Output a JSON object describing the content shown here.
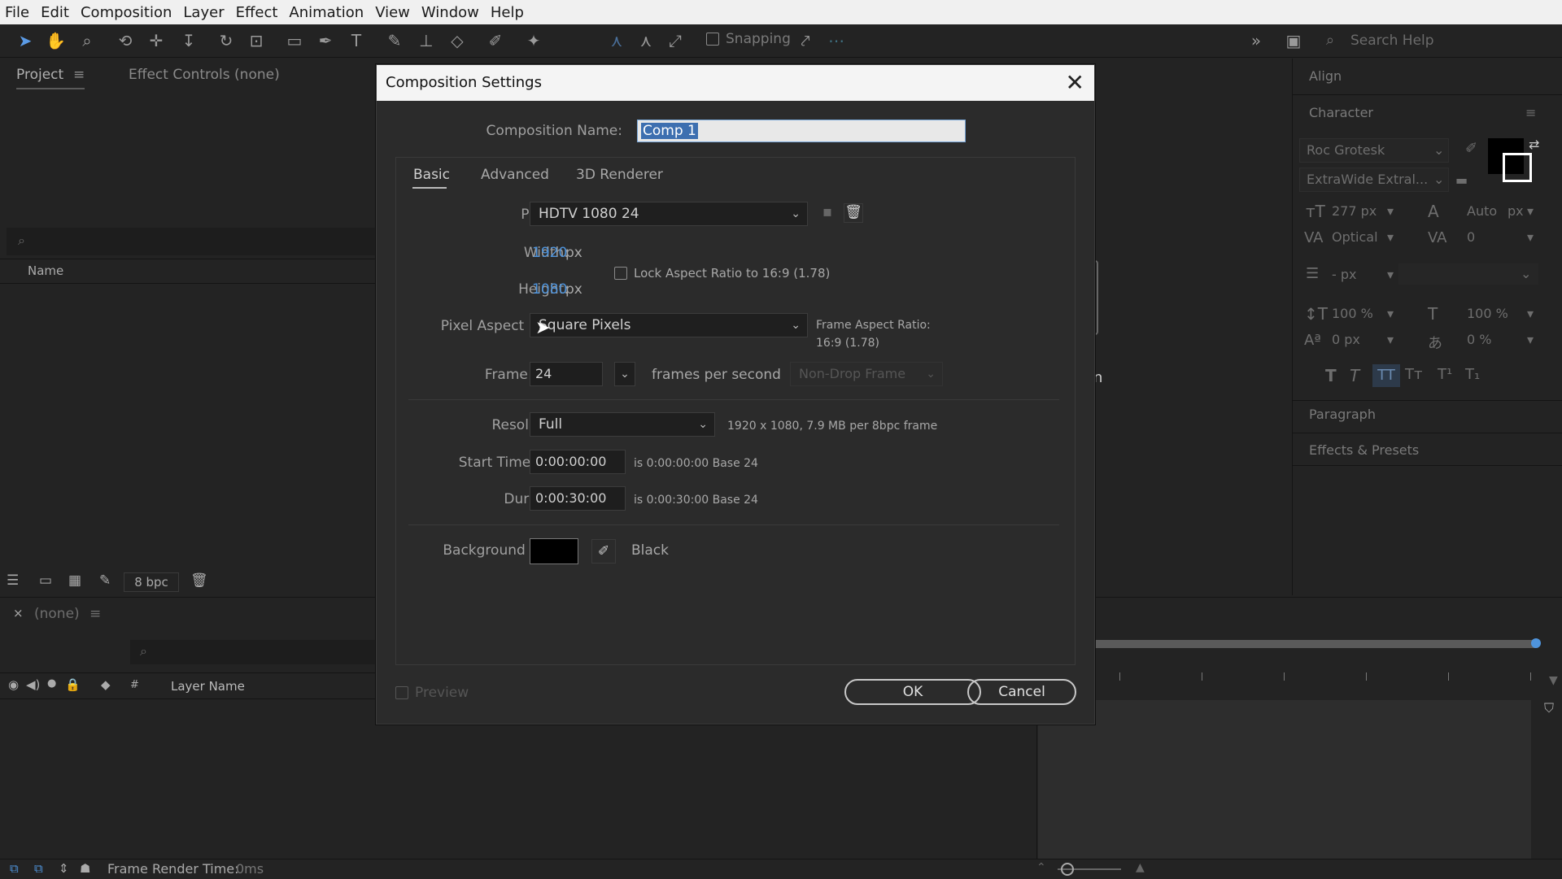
{
  "menu": [
    "File",
    "Edit",
    "Composition",
    "Layer",
    "Effect",
    "Animation",
    "View",
    "Window",
    "Help"
  ],
  "toolbar": {
    "snapping_label": "Snapping",
    "search_placeholder": "Search Help"
  },
  "project_panel": {
    "tab_project": "Project",
    "tab_effect_controls": "Effect Controls (none)",
    "column_name": "Name",
    "bpc": "8 bpc"
  },
  "timeline_panel": {
    "tab_label": "(none)",
    "column_layer_name": "Layer Name",
    "column_hash": "#",
    "frame_render_label": "Frame Render Time:",
    "frame_render_value": "0ms"
  },
  "right_panel": {
    "align": "Align",
    "character": "Character",
    "font": "Roc Grotesk",
    "font_style": "ExtraWide Extral...",
    "size": "277 px",
    "leading": "Auto",
    "leading_unit": "px",
    "kerning": "Optical",
    "tracking": "0",
    "stroke_width": "- px",
    "vscale": "100 %",
    "hscale": "100 %",
    "baseline": "0 px",
    "tsume": "0 %",
    "paragraph": "Paragraph",
    "effects_presets": "Effects & Presets"
  },
  "dialog": {
    "title": "Composition Settings",
    "comp_name_label": "Composition Name:",
    "comp_name_value": "Comp 1",
    "tabs": [
      "Basic",
      "Advanced",
      "3D Renderer"
    ],
    "preset_label": "Preset:",
    "preset_value": "HDTV 1080 24",
    "width_label": "Width:",
    "width_value": "1920",
    "width_unit": "px",
    "height_label": "Height:",
    "height_value": "1080",
    "height_unit": "px",
    "lock_aspect_label": "Lock Aspect Ratio to 16:9 (1.78)",
    "par_label": "Pixel Aspect Ratio:",
    "par_value": "Square Pixels",
    "far_label": "Frame Aspect Ratio:",
    "far_value": "16:9 (1.78)",
    "framerate_label": "Frame Rate:",
    "framerate_value": "24",
    "fps_label": "frames per second",
    "drop_frame": "Non-Drop Frame",
    "resolution_label": "Resolution:",
    "resolution_value": "Full",
    "resolution_info": "1920 x 1080, 7.9 MB per 8bpc frame",
    "start_tc_label": "Start Timecode:",
    "start_tc_value": "0:00:00:00",
    "start_tc_info": "is 0:00:00:00  Base 24",
    "duration_label": "Duration:",
    "duration_value": "0:00:30:00",
    "duration_info": "is 0:00:30:00  Base 24",
    "bg_label": "Background Color:",
    "bg_name": "Black",
    "bg_color": "#000000",
    "preview_label": "Preview",
    "ok_label": "OK",
    "cancel_label": "Cancel"
  },
  "partial_text": "n"
}
